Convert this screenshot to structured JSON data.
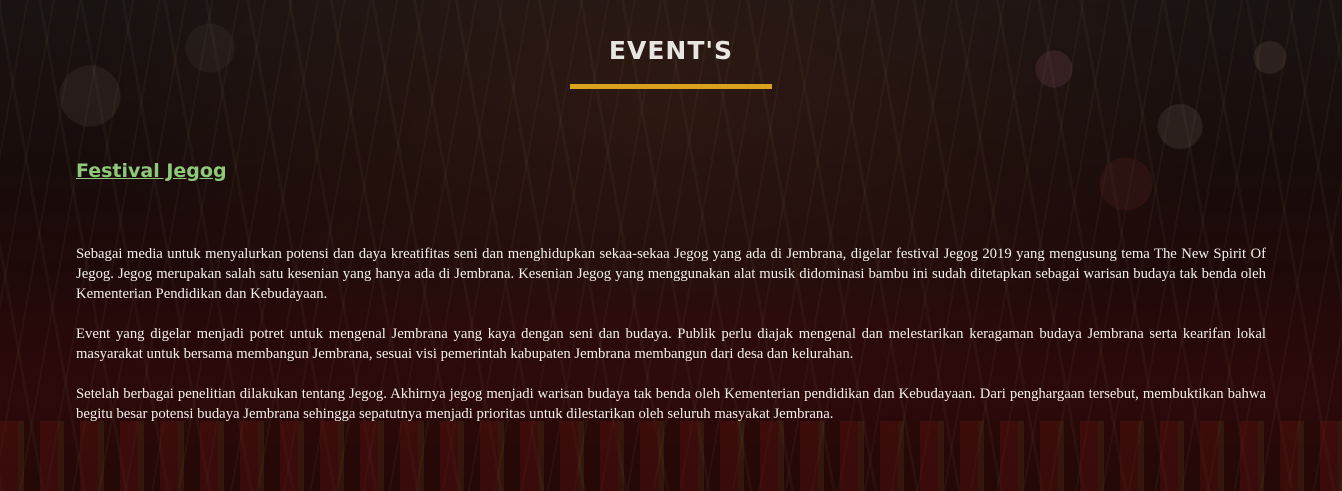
{
  "section": {
    "title": "EVENT'S",
    "accent_color": "#d9a21e"
  },
  "event": {
    "title": "Festival Jegog",
    "link_color": "#8fc97a",
    "paragraphs": [
      "Sebagai media untuk menyalurkan potensi dan daya kreatifitas seni dan menghidupkan sekaa-sekaa Jegog yang ada di Jembrana, digelar festival Jegog 2019 yang mengusung tema The New Spirit Of Jegog. Jegog merupakan salah satu kesenian yang hanya ada di Jembrana. Kesenian Jegog yang menggunakan alat musik didominasi bambu ini sudah ditetapkan sebagai warisan budaya tak benda oleh Kementerian Pendidikan dan Kebudayaan.",
      "Event yang digelar menjadi potret untuk mengenal Jembrana yang kaya dengan seni dan budaya. Publik perlu diajak mengenal dan melestarikan keragaman budaya Jembrana serta kearifan lokal masyarakat untuk bersama membangun Jembrana, sesuai visi pemerintah kabupaten Jembrana membangun dari desa dan kelurahan.",
      "Setelah berbagai penelitian dilakukan tentang Jegog. Akhirnya jegog menjadi warisan budaya tak benda oleh Kementerian pendidikan dan Kebudayaan. Dari penghargaan tersebut, membuktikan bahwa begitu besar potensi budaya Jembrana sehingga sepatutnya menjadi prioritas untuk dilestarikan oleh seluruh masyakat Jembrana."
    ]
  }
}
